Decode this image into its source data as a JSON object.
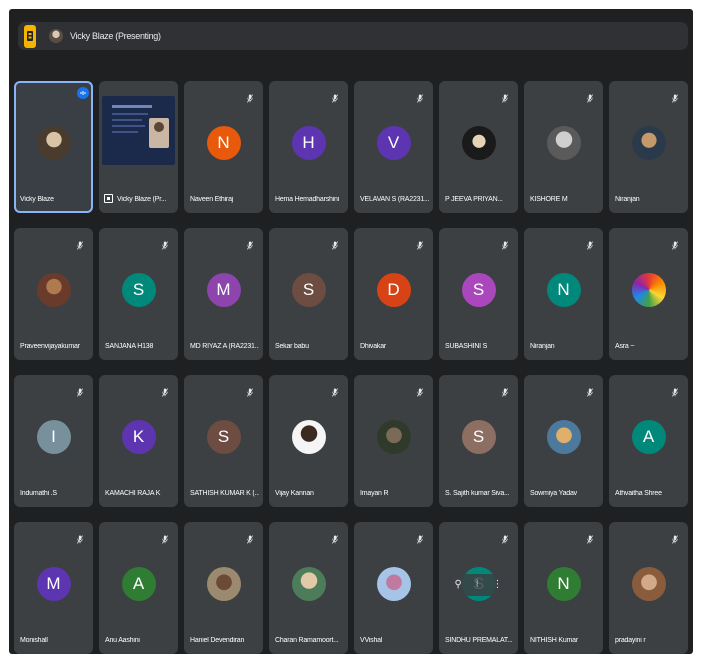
{
  "presenting_bar": {
    "label": "Vicky Blaze (Presenting)"
  },
  "colors": {
    "background": "#1f2022",
    "tile": "#3c4043",
    "speaking_border": "#8ab4f8",
    "app_accent": "#f4b400"
  },
  "participants": [
    {
      "name": "Vicky Blaze",
      "avatar": "photo",
      "speaking": true
    },
    {
      "name": "Vicky Blaze (Pr...",
      "avatar": "screen",
      "presenting": true
    },
    {
      "name": "Naveen Ethiraj",
      "avatar": "N",
      "color": "#e8590c"
    },
    {
      "name": "Hema Hemadharshini",
      "avatar": "H",
      "color": "#5e35b1"
    },
    {
      "name": "VELAVAN S (RA2231...",
      "avatar": "V",
      "color": "#5e35b1"
    },
    {
      "name": "P JEEVA PRIYAN...",
      "avatar": "photo"
    },
    {
      "name": "KISHORE M",
      "avatar": "photo"
    },
    {
      "name": "Niranjan",
      "avatar": "photo"
    },
    {
      "name": "Praveenvijayakumar",
      "avatar": "photo"
    },
    {
      "name": "SANJANA H138",
      "avatar": "S",
      "color": "#00897b"
    },
    {
      "name": "MD RIYAZ A (RA2231...",
      "avatar": "M",
      "color": "#8e44ad"
    },
    {
      "name": "Sekar babu",
      "avatar": "S",
      "color": "#6d4c41"
    },
    {
      "name": "Dhivakar",
      "avatar": "D",
      "color": "#d84315"
    },
    {
      "name": "SUBASHINI S",
      "avatar": "S",
      "color": "#ab47bc"
    },
    {
      "name": "Niranjan",
      "avatar": "N",
      "color": "#00897b"
    },
    {
      "name": "Asra ~",
      "avatar": "photo"
    },
    {
      "name": "Indumathi .S",
      "avatar": "I",
      "color": "#78909c"
    },
    {
      "name": "KAMACHI RAJA K",
      "avatar": "K",
      "color": "#5e35b1"
    },
    {
      "name": "SATHISH KUMAR K (...",
      "avatar": "S",
      "color": "#6d4c41"
    },
    {
      "name": "Vijay Kannan",
      "avatar": "photo"
    },
    {
      "name": "Imayan R",
      "avatar": "photo"
    },
    {
      "name": "S. Sajith kumar Siva...",
      "avatar": "S",
      "color": "#8d6e63"
    },
    {
      "name": "Sowmiya Yadav",
      "avatar": "photo"
    },
    {
      "name": "Athvaitha Shree",
      "avatar": "A",
      "color": "#00897b"
    },
    {
      "name": "Monishall",
      "avatar": "M",
      "color": "#5e35b1"
    },
    {
      "name": "Anu Aashini",
      "avatar": "A",
      "color": "#2e7d32"
    },
    {
      "name": "Haniel Devendiran",
      "avatar": "photo"
    },
    {
      "name": "Charan Ramamoort...",
      "avatar": "photo"
    },
    {
      "name": "VVishal",
      "avatar": "photo"
    },
    {
      "name": "SINDHU PREMALAT...",
      "avatar": "S",
      "color": "#00897b",
      "hovered": true
    },
    {
      "name": "NITHISH Kumar",
      "avatar": "N",
      "color": "#2e7d32"
    },
    {
      "name": "pradayini r",
      "avatar": "photo"
    }
  ]
}
